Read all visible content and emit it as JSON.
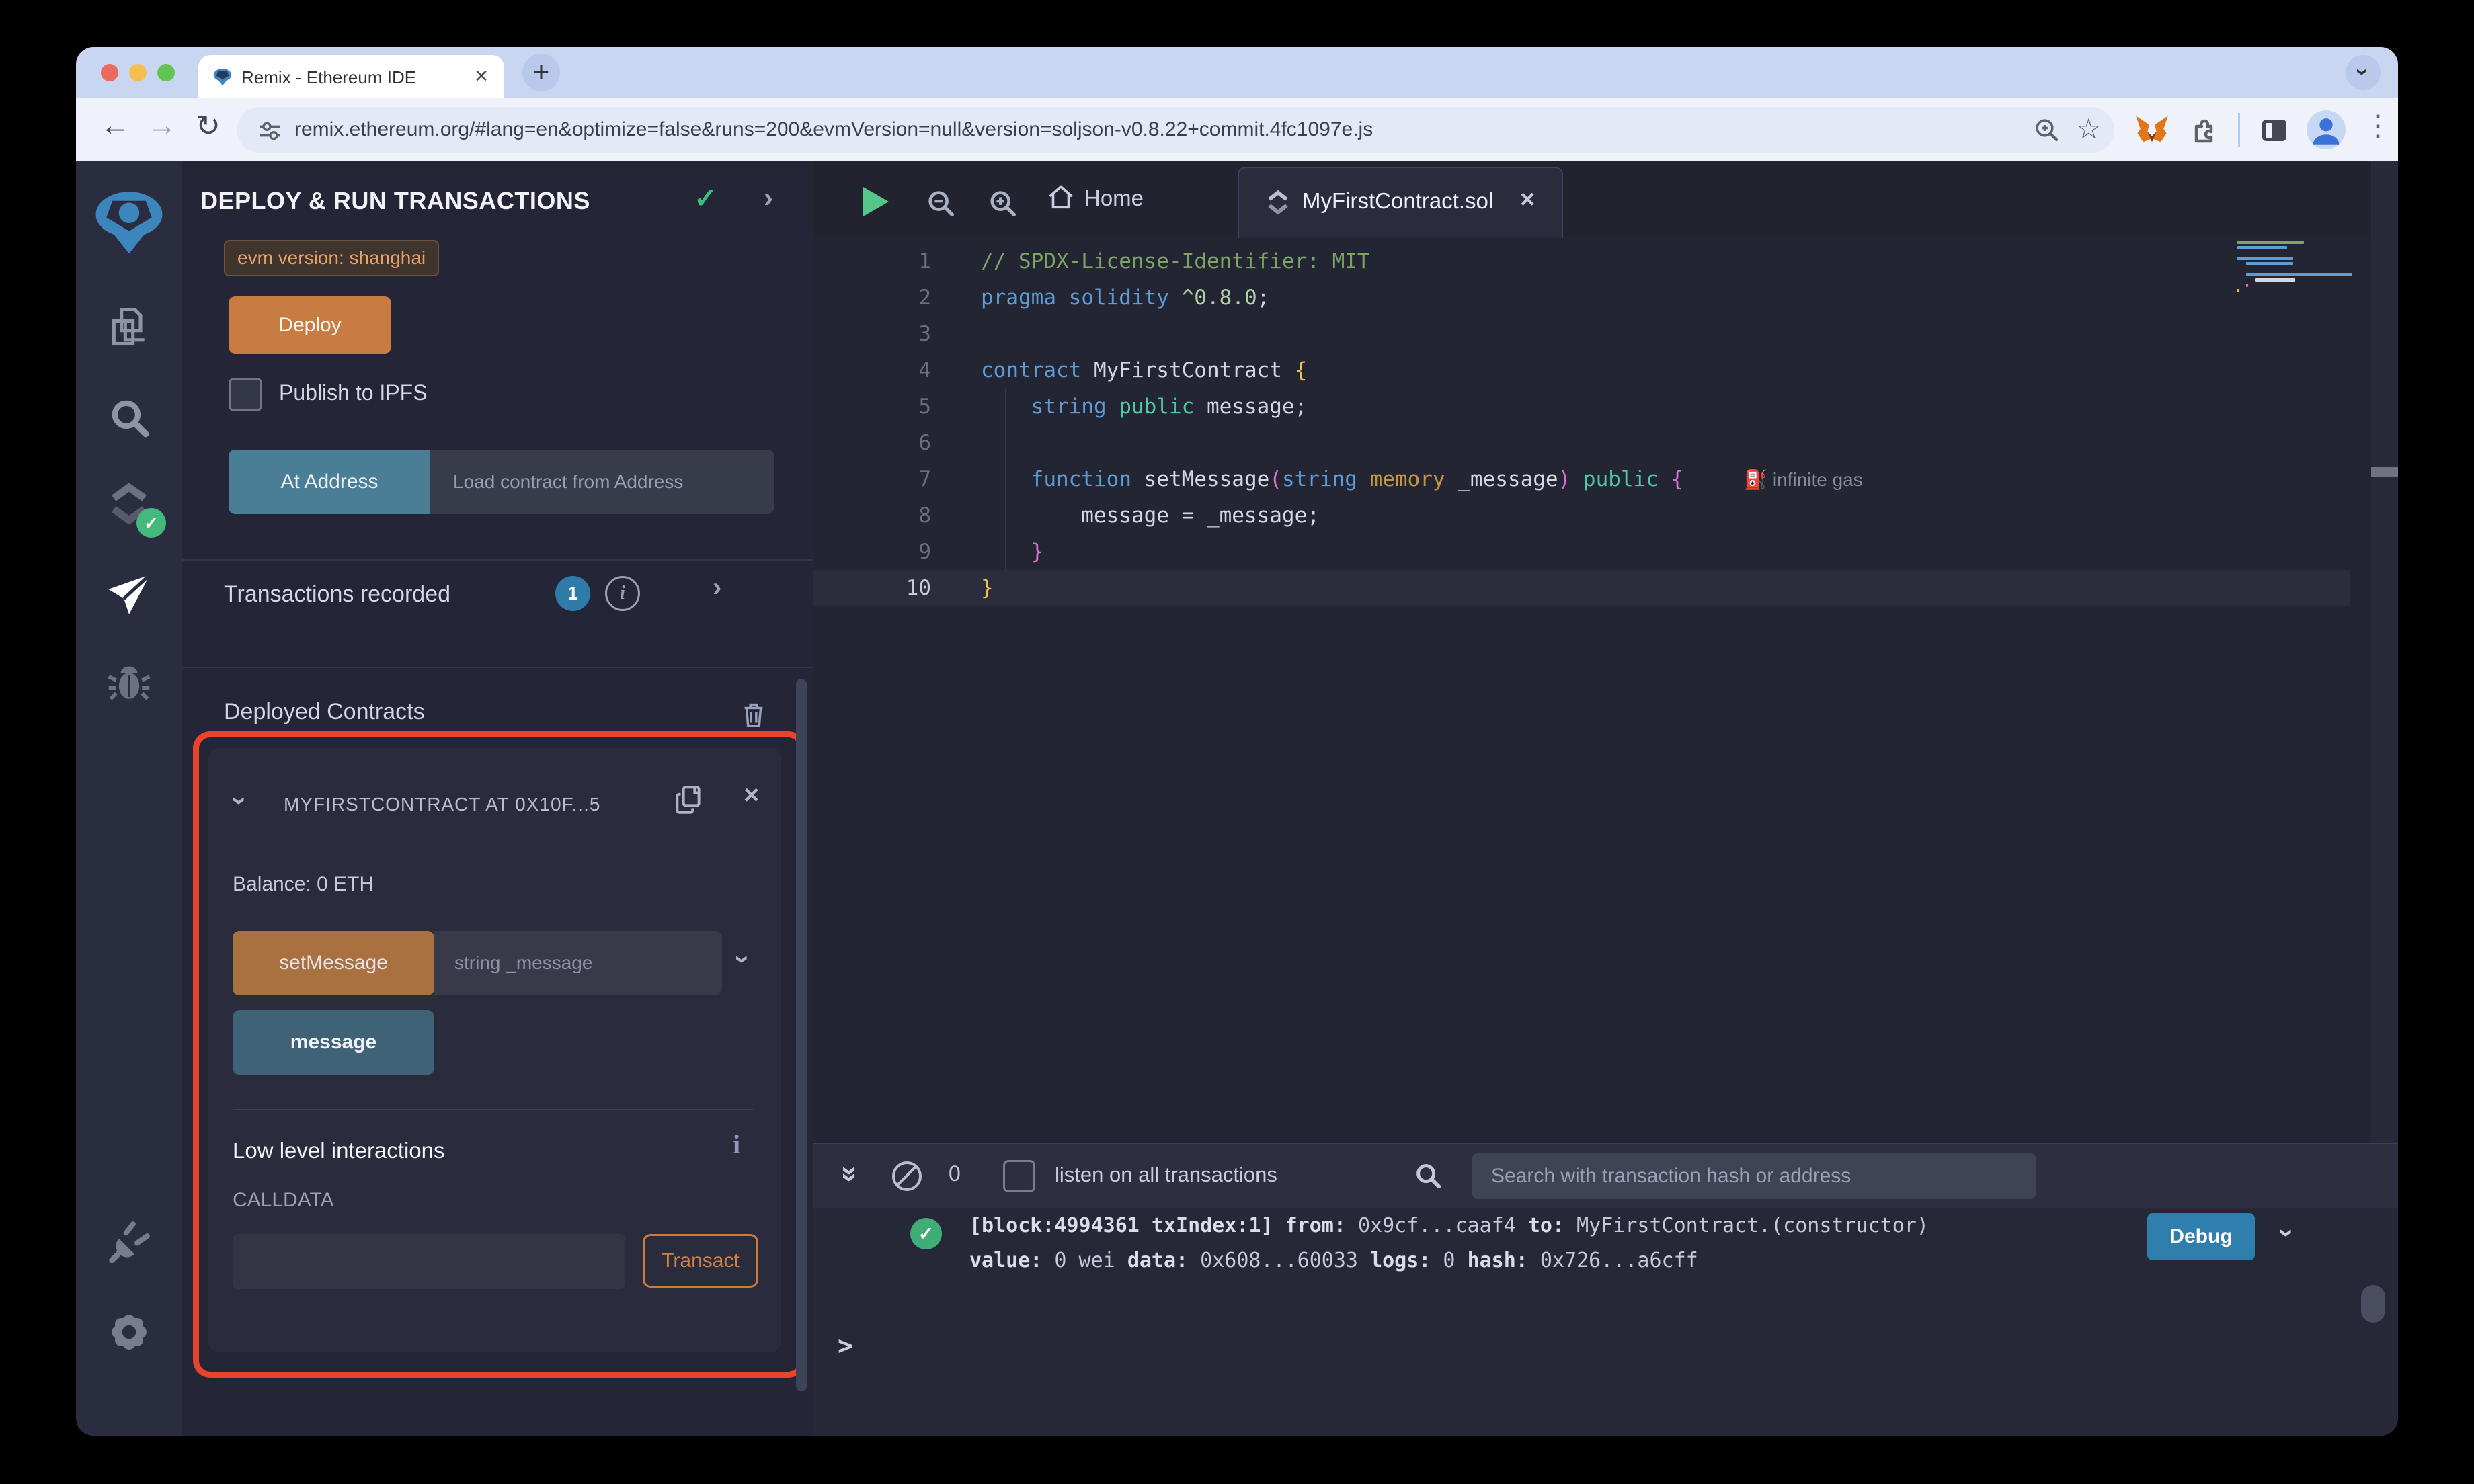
{
  "browser": {
    "tab_title": "Remix - Ethereum IDE",
    "url": "remix.ethereum.org/#lang=en&optimize=false&runs=200&evmVersion=null&version=soljson-v0.8.22+commit.4fc1097e.js"
  },
  "icons": {
    "back": "←",
    "forward": "→",
    "reload": "↻",
    "menu_kebab": "⋮",
    "new_tab": "+",
    "close": "×",
    "check": "✓",
    "chevron_right": "›",
    "double_chevron": "»",
    "info": "i",
    "star": "☆",
    "prompt": ">"
  },
  "side_panel": {
    "title": "DEPLOY & RUN TRANSACTIONS",
    "evm_badge": "evm version: shanghai",
    "deploy_button": "Deploy",
    "publish_label": "Publish to IPFS",
    "at_address_button": "At Address",
    "at_address_placeholder": "Load contract from Address",
    "transactions_label": "Transactions recorded",
    "transactions_count": "1",
    "deployed_title": "Deployed Contracts",
    "contract": {
      "title": "MYFIRSTCONTRACT AT 0X10F...5",
      "balance": "Balance: 0 ETH",
      "set_message_button": "setMessage",
      "set_message_placeholder": "string _message",
      "message_button": "message",
      "low_level_label": "Low level interactions",
      "calldata_label": "CALLDATA",
      "transact_button": "Transact"
    }
  },
  "editor": {
    "home_tab": "Home",
    "file_tab": "MyFirstContract.sol",
    "code": {
      "lines": [
        {
          "n": 1,
          "tokens": [
            {
              "t": "// SPDX-License-Identifier: MIT",
              "c": "com"
            }
          ]
        },
        {
          "n": 2,
          "tokens": [
            {
              "t": "pragma",
              "c": "kw"
            },
            {
              "t": " ",
              "c": "pl"
            },
            {
              "t": "solidity",
              "c": "kw"
            },
            {
              "t": " ",
              "c": "pl"
            },
            {
              "t": "^0.8.0",
              "c": "num"
            },
            {
              "t": ";",
              "c": "pl"
            }
          ]
        },
        {
          "n": 3,
          "tokens": []
        },
        {
          "n": 4,
          "tokens": [
            {
              "t": "contract",
              "c": "kw"
            },
            {
              "t": " MyFirstContract ",
              "c": "pl"
            },
            {
              "t": "{",
              "c": "by"
            }
          ]
        },
        {
          "n": 5,
          "tokens": [
            {
              "t": "    ",
              "c": "pl"
            },
            {
              "t": "string",
              "c": "kw"
            },
            {
              "t": " ",
              "c": "pl"
            },
            {
              "t": "public",
              "c": "mod"
            },
            {
              "t": " message;",
              "c": "pl"
            }
          ]
        },
        {
          "n": 6,
          "tokens": []
        },
        {
          "n": 7,
          "tokens": [
            {
              "t": "    ",
              "c": "pl"
            },
            {
              "t": "function",
              "c": "kw"
            },
            {
              "t": " setMessage",
              "c": "pl"
            },
            {
              "t": "(",
              "c": "bp"
            },
            {
              "t": "string",
              "c": "kw"
            },
            {
              "t": " ",
              "c": "pl"
            },
            {
              "t": "memory",
              "c": "gold"
            },
            {
              "t": " _message",
              "c": "pl"
            },
            {
              "t": ")",
              "c": "bp"
            },
            {
              "t": " ",
              "c": "pl"
            },
            {
              "t": "public",
              "c": "mod"
            },
            {
              "t": " ",
              "c": "pl"
            },
            {
              "t": "{",
              "c": "bp"
            }
          ],
          "gas": "infinite gas"
        },
        {
          "n": 8,
          "tokens": [
            {
              "t": "        message = _message;",
              "c": "pl"
            }
          ]
        },
        {
          "n": 9,
          "tokens": [
            {
              "t": "    ",
              "c": "pl"
            },
            {
              "t": "}",
              "c": "bp"
            }
          ]
        },
        {
          "n": 10,
          "tokens": [
            {
              "t": "}",
              "c": "by"
            }
          ],
          "active": true
        }
      ]
    }
  },
  "terminal": {
    "count": "0",
    "listen_label": "listen on all transactions",
    "search_placeholder": "Search with transaction hash or address",
    "debug_button": "Debug",
    "log_lines": [
      [
        {
          "t": "[block:4994361 txIndex:1]",
          "b": 1
        },
        {
          "t": " "
        },
        {
          "t": "from:",
          "b": 1
        },
        {
          "t": " 0x9cf...caaf4 "
        },
        {
          "t": "to:",
          "b": 1
        },
        {
          "t": " MyFirstContract.(constructor) "
        }
      ],
      [
        {
          "t": "value:",
          "b": 1
        },
        {
          "t": " 0 wei "
        },
        {
          "t": "data:",
          "b": 1
        },
        {
          "t": " 0x608...60033 "
        },
        {
          "t": "logs:",
          "b": 1
        },
        {
          "t": " 0 "
        },
        {
          "t": "hash:",
          "b": 1
        },
        {
          "t": " 0x726...a6cff"
        }
      ]
    ]
  },
  "colors": {
    "annotation_red": "#e8432b",
    "accent_orange": "#c87c42",
    "accent_teal": "#4a7e96",
    "debug_blue": "#2f7fae",
    "success_green": "#3fae76"
  }
}
